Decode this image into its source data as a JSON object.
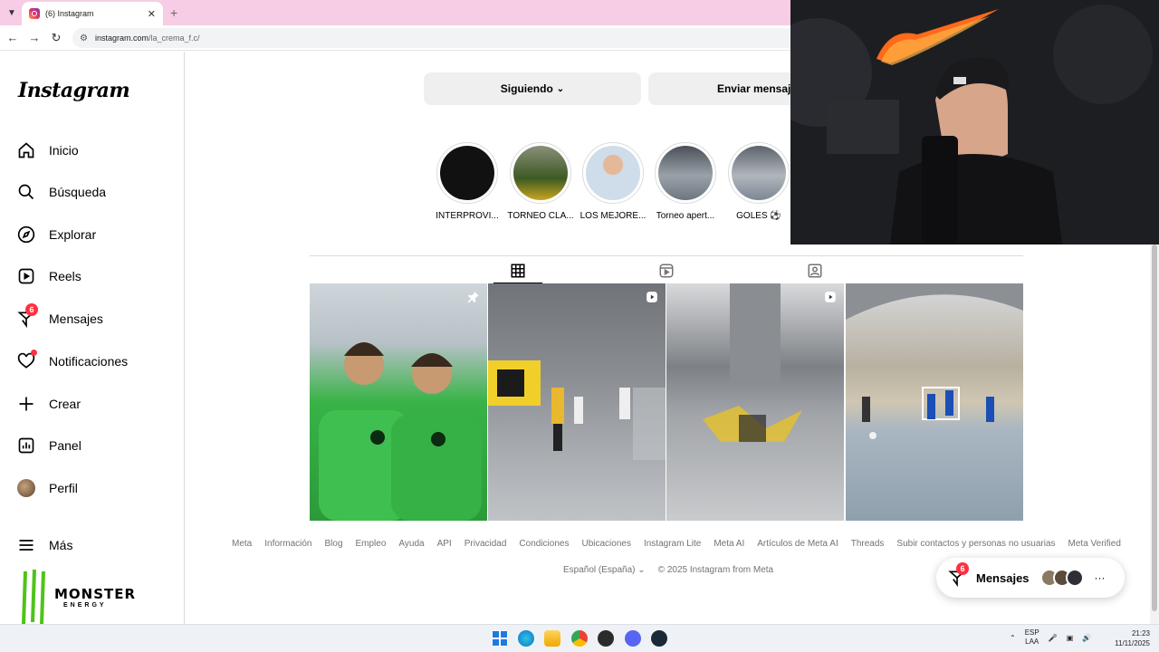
{
  "browser": {
    "tab_title": "(6) Instagram",
    "new_tab": "+",
    "url_domain": "instagram.com",
    "url_path": "/la_crema_f.c/"
  },
  "sidebar": {
    "logo": "Instagram",
    "items": [
      {
        "label": "Inicio",
        "icon": "home-icon"
      },
      {
        "label": "Búsqueda",
        "icon": "search-icon"
      },
      {
        "label": "Explorar",
        "icon": "compass-icon"
      },
      {
        "label": "Reels",
        "icon": "reels-icon"
      },
      {
        "label": "Mensajes",
        "icon": "messenger-icon",
        "badge": "6"
      },
      {
        "label": "Notificaciones",
        "icon": "heart-icon"
      },
      {
        "label": "Crear",
        "icon": "plus-icon"
      },
      {
        "label": "Panel",
        "icon": "dashboard-icon"
      },
      {
        "label": "Perfil",
        "icon": "avatar"
      }
    ],
    "more": "Más",
    "monster_text": "MONSTER",
    "monster_sub": "ENERGY"
  },
  "profile": {
    "follow_button": "Siguiendo",
    "message_button": "Enviar mensaje"
  },
  "highlights": [
    {
      "label": "INTERPROVI...",
      "color": "#111111"
    },
    {
      "label": "TORNEO CLA...",
      "color": "#4a6b2a"
    },
    {
      "label": "LOS MEJORE...",
      "color": "#9fb7d4"
    },
    {
      "label": "Torneo apert...",
      "color": "#6f7a86"
    },
    {
      "label": "GOLES ⚽",
      "color": "#7c8794"
    }
  ],
  "posts": [
    {
      "type": "pinned",
      "icon": "pin-icon"
    },
    {
      "type": "reel",
      "icon": "reel-badge-icon"
    },
    {
      "type": "reel",
      "icon": "reel-badge-icon"
    },
    {
      "type": "photo",
      "icon": ""
    }
  ],
  "footer": {
    "links": [
      "Meta",
      "Información",
      "Blog",
      "Empleo",
      "Ayuda",
      "API",
      "Privacidad",
      "Condiciones",
      "Ubicaciones",
      "Instagram Lite",
      "Meta AI",
      "Artículos de Meta AI",
      "Threads",
      "Subir contactos y personas no usuarias",
      "Meta Verified"
    ],
    "language": "Español (España)",
    "copyright": "© 2025 Instagram from Meta"
  },
  "messages_pill": {
    "label": "Mensajes",
    "badge": "6",
    "more": "···"
  },
  "taskbar": {
    "lang_top": "ESP",
    "lang_bottom": "LAA",
    "time": "21:23",
    "date": "11/11/2025"
  },
  "colors": {
    "accent_red": "#ff3040",
    "tab_bar": "#f6cde4",
    "button_bg": "#efefef"
  }
}
